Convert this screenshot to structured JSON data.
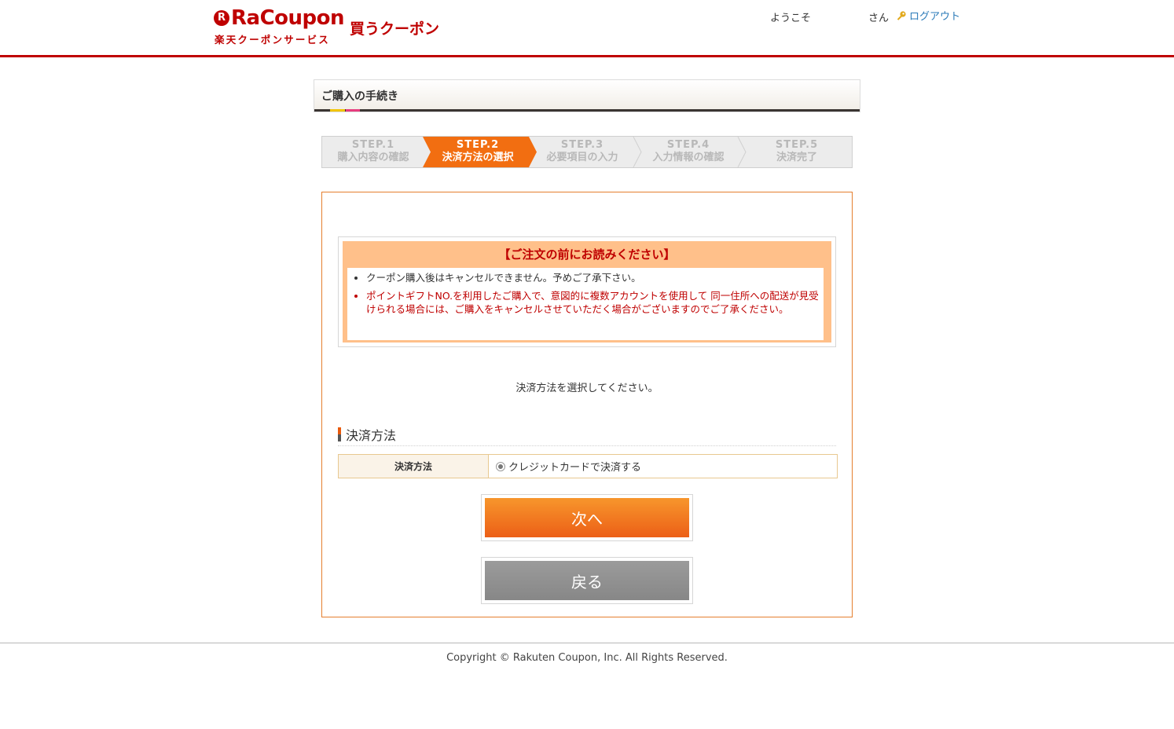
{
  "header": {
    "logo_letter": "R",
    "logo_word": "RaCoupon",
    "logo_sub": "楽天クーポンサービス",
    "logo_tag": "買うクーポン",
    "welcome": "ようこそ",
    "san": "さん",
    "logout": "ログアウト",
    "accent_color": "#bf0000"
  },
  "page_title": "ご購入の手続き",
  "steps": [
    {
      "num": "STEP.1",
      "label": "購入内容の確認",
      "active": false
    },
    {
      "num": "STEP.2",
      "label": "決済方法の選択",
      "active": true
    },
    {
      "num": "STEP.3",
      "label": "必要項目の入力",
      "active": false
    },
    {
      "num": "STEP.4",
      "label": "入力情報の確認",
      "active": false
    },
    {
      "num": "STEP.5",
      "label": "決済完了",
      "active": false
    }
  ],
  "notice": {
    "title": "【ご注文の前にお読みください】",
    "items": [
      "クーポン購入後はキャンセルできません。予めご了承下さい。",
      "ポイントギフトNO.を利用したご購入で、意図的に複数アカウントを使用して 同一住所への配送が見受けられる場合には、ご購入をキャンセルさせていただく場合がございますのでご了承ください。"
    ]
  },
  "instruction": "決済方法を選択してください。",
  "section_title": "決済方法",
  "payment": {
    "header": "決済方法",
    "option": "クレジットカードで決済する",
    "selected": true
  },
  "buttons": {
    "next": "次へ",
    "back": "戻る"
  },
  "footer": {
    "copyright": "Copyright © Rakuten Coupon, Inc. All Rights Reserved."
  },
  "colors": {
    "step_active": "#f26e11",
    "button_next": "#f0781f",
    "button_back": "#8f8f8f",
    "notice_bg": "#ffc08a"
  }
}
